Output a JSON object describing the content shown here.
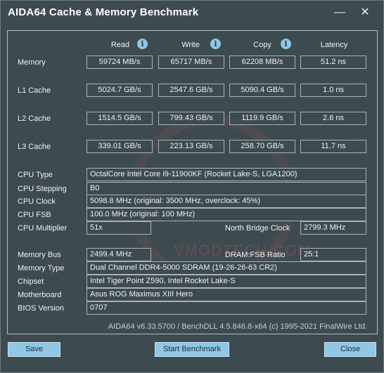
{
  "window": {
    "title": "AIDA64 Cache & Memory Benchmark",
    "minimize": "—",
    "close": "✕"
  },
  "columns": {
    "read": "Read",
    "write": "Write",
    "copy": "Copy",
    "latency": "Latency",
    "info_glyph": "i"
  },
  "rows": [
    {
      "label": "Memory",
      "read": "59724 MB/s",
      "write": "65717 MB/s",
      "copy": "62208 MB/s",
      "latency": "51.2 ns"
    },
    {
      "label": "L1 Cache",
      "read": "5024.7 GB/s",
      "write": "2547.6 GB/s",
      "copy": "5090.4 GB/s",
      "latency": "1.0 ns"
    },
    {
      "label": "L2 Cache",
      "read": "1514.5 GB/s",
      "write": "799.43 GB/s",
      "copy": "1119.9 GB/s",
      "latency": "2.6 ns"
    },
    {
      "label": "L3 Cache",
      "read": "339.01 GB/s",
      "write": "223.13 GB/s",
      "copy": "258.70 GB/s",
      "latency": "11.7 ns"
    }
  ],
  "cpu": {
    "type_label": "CPU Type",
    "type_value": "OctalCore Intel Core i9-11900KF  (Rocket Lake-S, LGA1200)",
    "stepping_label": "CPU Stepping",
    "stepping_value": "B0",
    "clock_label": "CPU Clock",
    "clock_value": "5098.8 MHz  (original: 3500 MHz, overclock: 45%)",
    "fsb_label": "CPU FSB",
    "fsb_value": "100.0 MHz  (original: 100 MHz)",
    "multiplier_label": "CPU Multiplier",
    "multiplier_value": "51x",
    "nb_label": "North Bridge Clock",
    "nb_value": "2799.3 MHz"
  },
  "memory": {
    "bus_label": "Memory Bus",
    "bus_value": "2499.4 MHz",
    "ratio_label": "DRAM:FSB Ratio",
    "ratio_value": "25:1",
    "type_label": "Memory Type",
    "type_value": "Dual Channel DDR4-5000 SDRAM  (19-26-26-63 CR2)",
    "chipset_label": "Chipset",
    "chipset_value": "Intel Tiger Point Z590, Intel Rocket Lake-S",
    "mobo_label": "Motherboard",
    "mobo_value": "Asus ROG Maximus XIII Hero",
    "bios_label": "BIOS Version",
    "bios_value": "0707"
  },
  "footer": "AIDA64 v6.33.5700 / BenchDLL 4.5.846.8-x64  (c) 1995-2021 FinalWire Ltd.",
  "watermark": "VMODTECH.COM",
  "buttons": {
    "save": "Save",
    "start": "Start Benchmark",
    "close": "Close"
  }
}
